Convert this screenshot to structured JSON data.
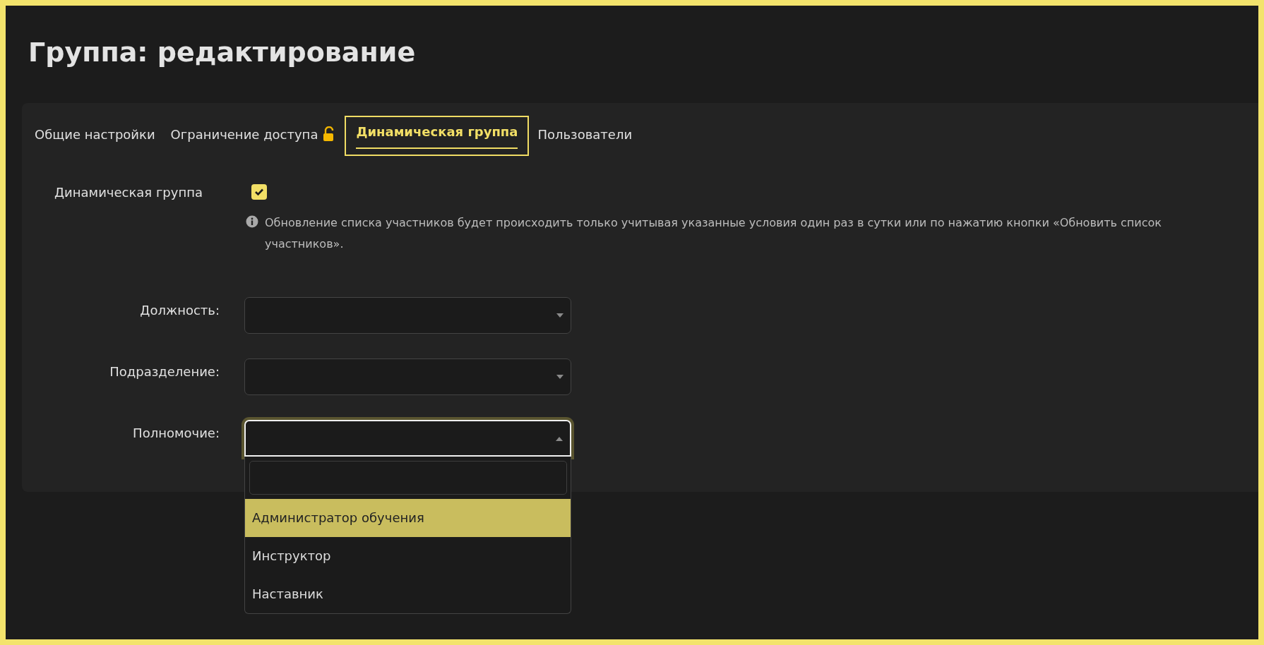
{
  "title": "Группа: редактирование",
  "tabs": [
    {
      "label": "Общие настройки",
      "selected": false,
      "locked": false
    },
    {
      "label": "Ограничение доступа",
      "selected": false,
      "locked": true
    },
    {
      "label": "Динамическая группа",
      "selected": true,
      "locked": false
    },
    {
      "label": "Пользователи",
      "selected": false,
      "locked": false
    }
  ],
  "dynamic_group": {
    "label": "Динамическая группа",
    "checked": true,
    "info": "Обновление списка участников будет происходить только учитывая указанные условия один раз в сутки или по нажатию кнопки «Обновить список участников»."
  },
  "fields": [
    {
      "label": "Должность:",
      "open": false
    },
    {
      "label": "Подразделение:",
      "open": false
    },
    {
      "label": "Полномочие:",
      "open": true,
      "options": [
        {
          "label": "Администратор обучения",
          "selected": true
        },
        {
          "label": "Инструктор",
          "selected": false
        },
        {
          "label": "Наставник",
          "selected": false
        }
      ]
    }
  ]
}
